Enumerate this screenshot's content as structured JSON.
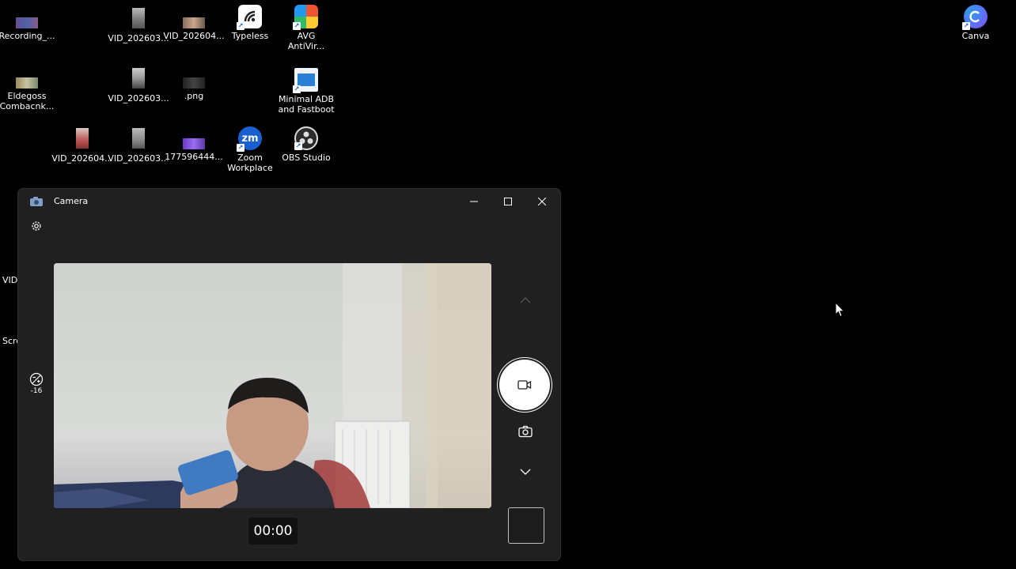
{
  "desktop": {
    "icons": [
      {
        "label": "Recording_...",
        "icon": "video-thumbnail-icon"
      },
      {
        "label": "VID_202603...",
        "icon": "video-thumbnail-icon"
      },
      {
        "label": "VID_202604...",
        "icon": "video-thumbnail-icon"
      },
      {
        "label": "Typeless",
        "icon": "typeless-app-icon"
      },
      {
        "label": "AVG\nAntiVir...",
        "icon": "avg-antivirus-icon"
      },
      {
        "label": "Canva",
        "icon": "canva-app-icon"
      },
      {
        "label": "Eldegoss\nCombacnk...",
        "icon": "video-thumbnail-icon"
      },
      {
        "label": "VID_202603...",
        "icon": "video-thumbnail-icon"
      },
      {
        "label": ".png",
        "icon": "image-thumbnail-icon"
      },
      {
        "label": "Minimal ADB\nand Fastboot",
        "icon": "minimal-adb-icon"
      },
      {
        "label": "VID_202604...",
        "icon": "video-thumbnail-icon"
      },
      {
        "label": "VID_202603...",
        "icon": "video-thumbnail-icon"
      },
      {
        "label": "177596444...",
        "icon": "image-thumbnail-icon"
      },
      {
        "label": "Zoom\nWorkplace",
        "icon": "zoom-app-icon"
      },
      {
        "label": "OBS Studio",
        "icon": "obs-studio-icon"
      }
    ],
    "partial_labels": [
      "VID_",
      "Scre"
    ]
  },
  "camera": {
    "title": "Camera",
    "exposure_value": "-16",
    "timer": "00:00",
    "mode": "video"
  },
  "colors": {
    "desktop_bg": "#000000",
    "window_bg": "#202020",
    "record_button": "#ffffff"
  }
}
